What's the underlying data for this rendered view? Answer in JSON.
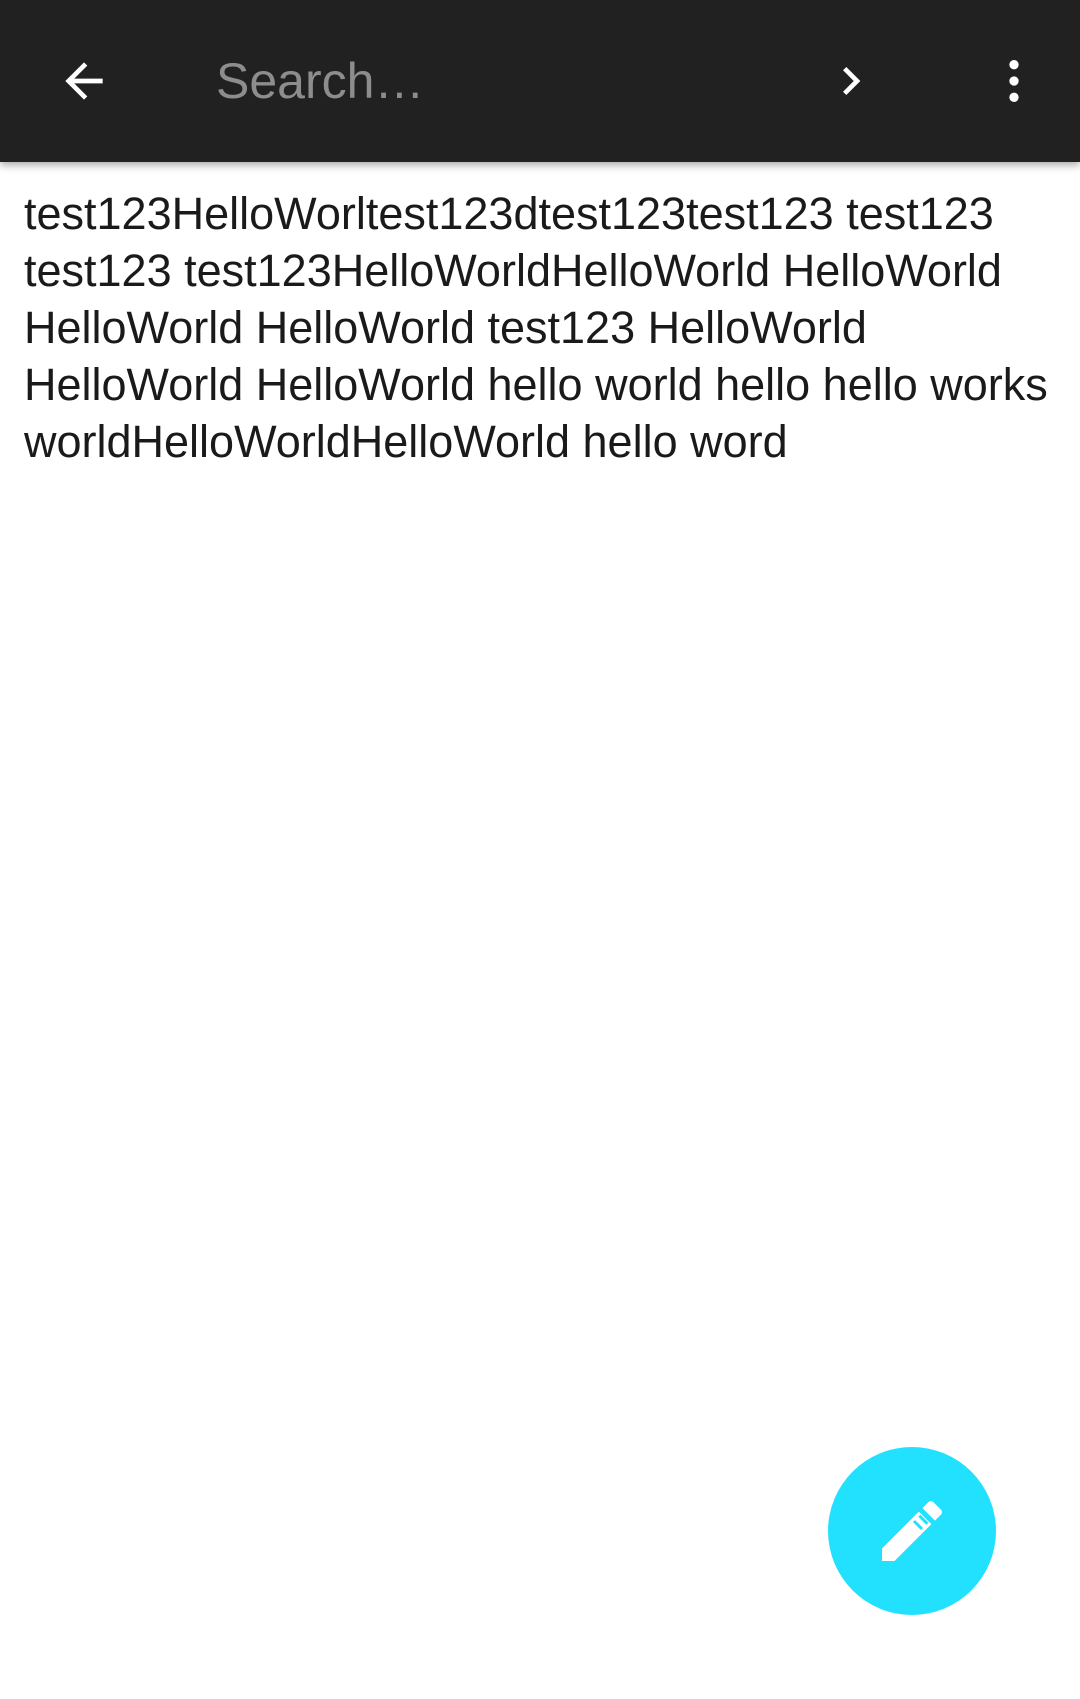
{
  "toolbar": {
    "back_icon": "arrow-left-icon",
    "search": {
      "placeholder": "Search…",
      "value": ""
    },
    "next_icon": "chevron-right-icon",
    "overflow_icon": "more-vert-icon"
  },
  "note": {
    "text": "test123HelloWorltest123dtest123test123 test123 test123 test123HelloWorldHelloWorld HelloWorld HelloWorld HelloWorld test123 HelloWorld HelloWorld HelloWorld hello world hello hello works worldHelloWorldHelloWorld hello word"
  },
  "fab": {
    "icon": "pencil-icon",
    "color": "#22e1ff"
  },
  "colors": {
    "toolbar_bg": "#212121",
    "background": "#ffffff",
    "text": "#1a1a1a",
    "placeholder": "#8d8d8d"
  }
}
